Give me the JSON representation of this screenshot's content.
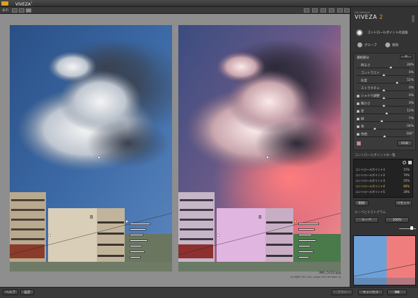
{
  "app": {
    "title": "VIVEZA",
    "version_badge": "2"
  },
  "toolbar": {
    "view_label": "表示:"
  },
  "image": {
    "filename": "IMG_5122.jpg",
    "meta": "(3.46MP, ISO 100, Canon EOS 5D Mark II)"
  },
  "sidebar": {
    "vendor": "Nik Software",
    "brand": "VIVEZA",
    "brand_version": "2",
    "add_cp_label": "コントロールポイントの追加",
    "group_label": "グループ",
    "delete_label": "削除",
    "selected_header": "選択部分",
    "sliders": [
      {
        "label": "明るさ",
        "value": "28%",
        "pos": 0.64,
        "checkbox": false
      },
      {
        "label": "コントラスト",
        "value": "0%",
        "pos": 0.5,
        "checkbox": false
      },
      {
        "label": "彩度",
        "value": "52%",
        "pos": 0.76,
        "checkbox": false
      },
      {
        "label": "ストラクチャ",
        "value": "0%",
        "pos": 0.5,
        "checkbox": false
      },
      {
        "label": "シャドウ調整",
        "value": "0%",
        "pos": 0.5,
        "checkbox": true
      },
      {
        "label": "暖かさ",
        "value": "0%",
        "pos": 0.5,
        "checkbox": true
      },
      {
        "label": "赤",
        "value": "11%",
        "pos": 0.55,
        "checkbox": true
      },
      {
        "label": "緑",
        "value": "-7%",
        "pos": 0.46,
        "checkbox": true
      },
      {
        "label": "青",
        "value": "-34%",
        "pos": 0.33,
        "checkbox": true
      },
      {
        "label": "色相",
        "value": "182°",
        "pos": 0.52,
        "checkbox": true
      }
    ],
    "color_mode": "RGB",
    "cp_list_header": "コントロールポイントの一覧",
    "cp_items": [
      {
        "name": "コントロールポイント1",
        "value": "15%",
        "selected": false
      },
      {
        "name": "コントロールポイント2",
        "value": "70%",
        "selected": false
      },
      {
        "name": "コントロールポイント3",
        "value": "25%",
        "selected": false
      },
      {
        "name": "コントロールポイント4",
        "value": "86%",
        "selected": true
      },
      {
        "name": "コントロールポイント5",
        "value": "28%",
        "selected": false
      }
    ],
    "cp_buttons": [
      "削除",
      "リセット"
    ],
    "loupe_header": "ルーペとヒストグラム",
    "loupe_select": "ルーペ",
    "zoom_select": "100%"
  },
  "bottom": {
    "help": "ヘルプ",
    "settings": "設定",
    "brush": "ブラシ",
    "cancel": "キャンセル",
    "ok": "OK"
  },
  "colors": {
    "accent": "#f0c040"
  }
}
